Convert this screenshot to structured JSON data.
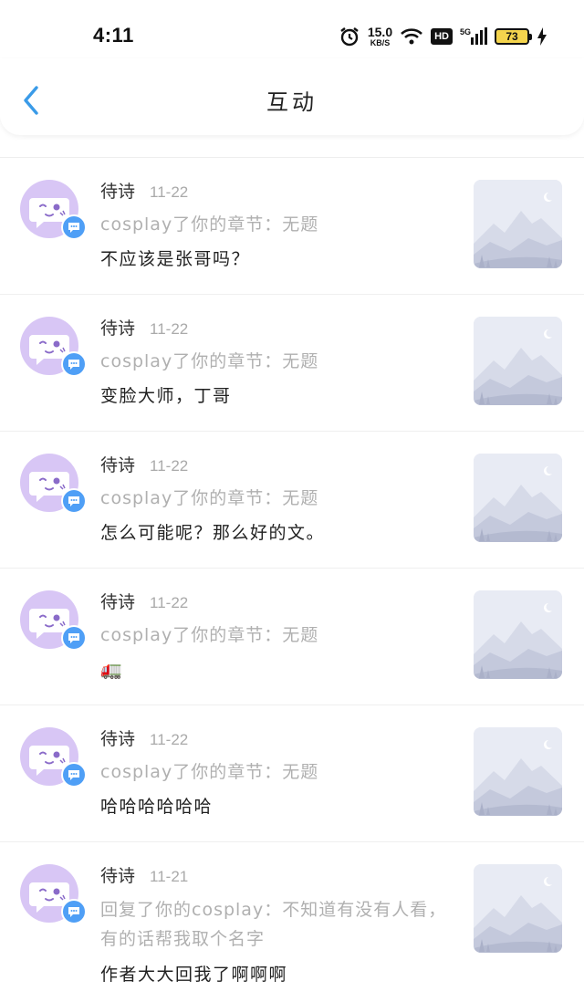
{
  "status": {
    "time": "4:11",
    "speed_value": "15.0",
    "speed_unit": "KB/S",
    "hd": "HD",
    "battery": "73"
  },
  "header": {
    "title": "互动",
    "back_icon": "chevron-left-icon"
  },
  "colors": {
    "accent": "#3a9be8",
    "avatar_bg": "#d8c6f5",
    "badge_blue": "#4f9ff6"
  },
  "items": [
    {
      "name": "待诗",
      "date": "11-22",
      "action": "cosplay了你的章节：无题",
      "text": "不应该是张哥吗？"
    },
    {
      "name": "待诗",
      "date": "11-22",
      "action": "cosplay了你的章节：无题",
      "text": "变脸大师，丁哥"
    },
    {
      "name": "待诗",
      "date": "11-22",
      "action": "cosplay了你的章节：无题",
      "text": "怎么可能呢？那么好的文。"
    },
    {
      "name": "待诗",
      "date": "11-22",
      "action": "cosplay了你的章节：无题",
      "text": "🚛"
    },
    {
      "name": "待诗",
      "date": "11-22",
      "action": "cosplay了你的章节：无题",
      "text": "哈哈哈哈哈哈"
    },
    {
      "name": "待诗",
      "date": "11-21",
      "action": "回复了你的cosplay：不知道有没有人看，有的话帮我取个名字",
      "text": "作者大大回我了啊啊啊"
    }
  ]
}
